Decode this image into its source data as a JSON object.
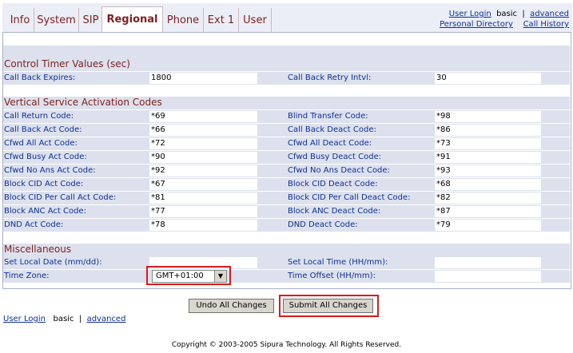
{
  "tabs": [
    "Info",
    "System",
    "SIP",
    "Regional",
    "Phone",
    "Ext 1",
    "User"
  ],
  "top_links": {
    "user_login": "User Login",
    "basic": "basic",
    "separator": "|",
    "advanced": "advanced",
    "personal_directory": "Personal Directory",
    "call_history": "Call History"
  },
  "sections": {
    "control_timer": "Control Timer Values (sec)",
    "vsac": "Vertical Service Activation Codes",
    "misc": "Miscellaneous"
  },
  "control_timer_rows": [
    {
      "left_label": "Call Back Expires:",
      "left_value": "1800",
      "right_label": "Call Back Retry Intvl:",
      "right_value": "30"
    }
  ],
  "vsac_rows": [
    {
      "left_label": "Call Return Code:",
      "left_value": "*69",
      "right_label": "Blind Transfer Code:",
      "right_value": "*98"
    },
    {
      "left_label": "Call Back Act Code:",
      "left_value": "*66",
      "right_label": "Call Back Deact Code:",
      "right_value": "*86"
    },
    {
      "left_label": "Cfwd All Act Code:",
      "left_value": "*72",
      "right_label": "Cfwd All Deact Code:",
      "right_value": "*73"
    },
    {
      "left_label": "Cfwd Busy Act Code:",
      "left_value": "*90",
      "right_label": "Cfwd Busy Deact Code:",
      "right_value": "*91"
    },
    {
      "left_label": "Cfwd No Ans Act Code:",
      "left_value": "*92",
      "right_label": "Cfwd No Ans Deact Code:",
      "right_value": "*93"
    },
    {
      "left_label": "Block CID Act Code:",
      "left_value": "*67",
      "right_label": "Block CID Deact Code:",
      "right_value": "*68"
    },
    {
      "left_label": "Block CID Per Call Act Code:",
      "left_value": "*81",
      "right_label": "Block CID Per Call Deact Code:",
      "right_value": "*82"
    },
    {
      "left_label": "Block ANC Act Code:",
      "left_value": "*77",
      "right_label": "Block ANC Deact Code:",
      "right_value": "*87"
    },
    {
      "left_label": "DND Act Code:",
      "left_value": "*78",
      "right_label": "DND Deact Code:",
      "right_value": "*79"
    }
  ],
  "misc_rows": [
    {
      "left_label": "Set Local Date (mm/dd):",
      "left_value": "",
      "right_label": "Set Local Time (HH/mm):",
      "right_value": ""
    },
    {
      "left_label": "Time Zone:",
      "left_value": "",
      "right_label": "Time Offset (HH/mm):",
      "right_value": ""
    }
  ],
  "time_zone": {
    "selected": "GMT+01:00",
    "arrow": "▼"
  },
  "buttons": {
    "undo": "Undo All Changes",
    "submit": "Submit All Changes"
  },
  "bottom_links": {
    "user_login": "User Login",
    "basic": "basic",
    "separator": "|",
    "advanced": "advanced"
  },
  "copyright": "Copyright © 2003-2005 Sipura Technology. All Rights Reserved."
}
